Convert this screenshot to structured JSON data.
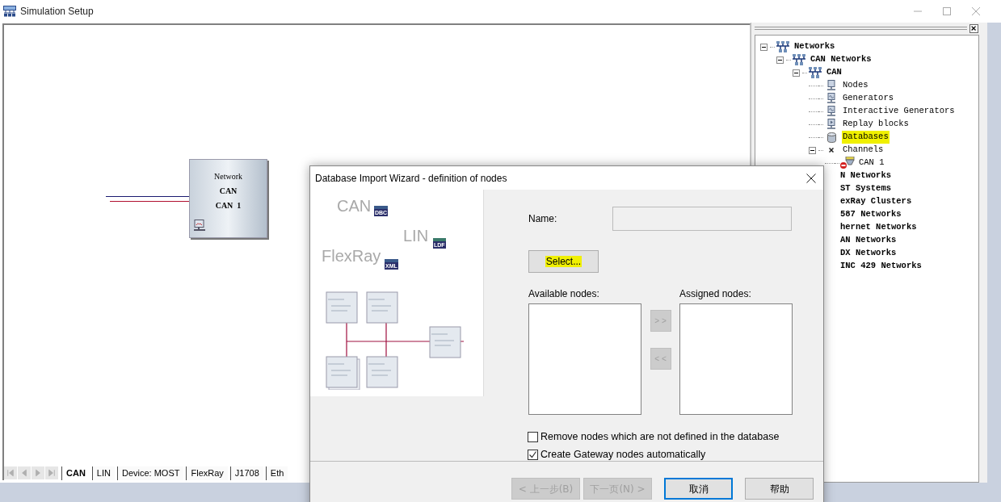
{
  "window": {
    "title": "Simulation Setup"
  },
  "canvas": {
    "node": {
      "heading": "Network",
      "type": "CAN",
      "name": "CAN  1"
    }
  },
  "sheet_tabs": [
    {
      "label": "CAN",
      "selected": true
    },
    {
      "label": "LIN",
      "selected": false
    },
    {
      "label": "Device: MOST",
      "selected": false
    },
    {
      "label": "FlexRay",
      "selected": false
    },
    {
      "label": "J1708",
      "selected": false
    },
    {
      "label": "Eth",
      "selected": false
    }
  ],
  "tree": {
    "items": [
      {
        "label": "Networks",
        "kind": "network",
        "expanded": true,
        "selected": false,
        "highlighted": false,
        "children": [
          {
            "label": "CAN Networks",
            "kind": "network",
            "expanded": true,
            "selected": false,
            "highlighted": false,
            "children": [
              {
                "label": "CAN",
                "kind": "network",
                "expanded": true,
                "selected": false,
                "highlighted": false,
                "children": [
                  {
                    "label": "Nodes",
                    "kind": "node",
                    "selected": false,
                    "highlighted": false
                  },
                  {
                    "label": "Generators",
                    "kind": "generator",
                    "selected": false,
                    "highlighted": false
                  },
                  {
                    "label": "Interactive Generators",
                    "kind": "generator",
                    "selected": false,
                    "highlighted": false
                  },
                  {
                    "label": "Replay blocks",
                    "kind": "replay",
                    "selected": false,
                    "highlighted": false
                  },
                  {
                    "label": "Databases",
                    "kind": "database",
                    "selected": false,
                    "highlighted": true
                  },
                  {
                    "label": "Channels",
                    "kind": "channels",
                    "expanded": true,
                    "selected": false,
                    "highlighted": false,
                    "children": [
                      {
                        "label": "CAN 1",
                        "kind": "channel",
                        "selected": false,
                        "highlighted": false
                      }
                    ]
                  }
                ]
              }
            ]
          },
          {
            "label": "N Networks",
            "kind": "partial",
            "selected": false,
            "highlighted": false
          },
          {
            "label": "ST Systems",
            "kind": "partial",
            "selected": false,
            "highlighted": false
          },
          {
            "label": "exRay Clusters",
            "kind": "partial",
            "selected": false,
            "highlighted": false
          },
          {
            "label": "587 Networks",
            "kind": "partial",
            "selected": false,
            "highlighted": false
          },
          {
            "label": "hernet Networks",
            "kind": "partial",
            "selected": false,
            "highlighted": false
          },
          {
            "label": "AN Networks",
            "kind": "partial",
            "selected": false,
            "highlighted": false
          },
          {
            "label": "DX Networks",
            "kind": "partial",
            "selected": false,
            "highlighted": false
          },
          {
            "label": "INC 429 Networks",
            "kind": "partial",
            "selected": false,
            "highlighted": false
          }
        ]
      }
    ]
  },
  "dialog": {
    "title": "Database Import Wizard - definition of nodes",
    "illustration": {
      "labels": [
        {
          "text": "CAN",
          "badge": "DBC"
        },
        {
          "text": "LIN",
          "badge": "LDF"
        },
        {
          "text": "FlexRay",
          "badge": "XML"
        }
      ]
    },
    "name_label": "Name:",
    "select_button": {
      "label": "Select...",
      "highlighted": true
    },
    "available_nodes": {
      "label": "Available nodes:"
    },
    "assigned_nodes": {
      "label": "Assigned nodes:"
    },
    "move_buttons": [
      {
        "label": "> >",
        "disabled": true
      },
      {
        "label": "< <",
        "disabled": true
      }
    ],
    "checkboxes": [
      {
        "label": "Remove nodes which are not defined in the database",
        "checked": false
      },
      {
        "label": "Create Gateway nodes automatically",
        "checked": true
      }
    ],
    "footer_buttons": [
      {
        "label": "< 上一步(B)",
        "disabled": true,
        "default": false
      },
      {
        "label": "下一页(N) >",
        "disabled": true,
        "default": false
      },
      {
        "label": "取消",
        "disabled": false,
        "default": true
      },
      {
        "label": "帮助",
        "disabled": false,
        "default": false
      }
    ]
  }
}
